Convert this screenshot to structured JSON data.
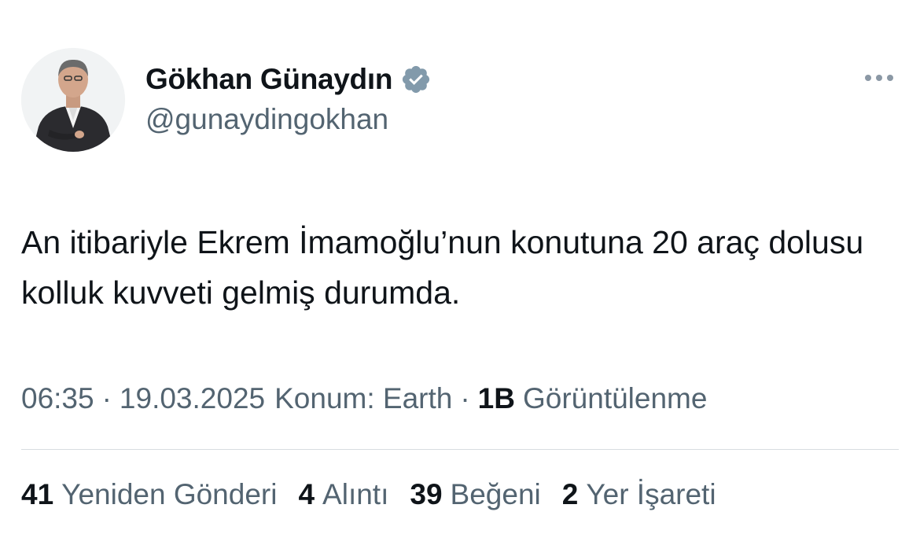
{
  "author": {
    "display_name": "Gökhan Günaydın",
    "handle": "@gunaydingokhan",
    "verified_badge_color": "#829aab",
    "icons": {
      "verified": "verified-badge-icon",
      "more": "more-options-icon"
    }
  },
  "tweet": {
    "text": "An itibariyle Ekrem İmamoğlu’nun konutuna 20 araç dolusu kolluk kuvveti gelmiş durumda."
  },
  "meta": {
    "time": "06:35",
    "separator": "·",
    "date": "19.03.2025",
    "location": "Konum: Earth",
    "views_count": "1B",
    "views_label": "Görüntülenme"
  },
  "stats": [
    {
      "count": "41",
      "label": "Yeniden Gönderi"
    },
    {
      "count": "4",
      "label": "Alıntı"
    },
    {
      "count": "39",
      "label": "Beğeni"
    },
    {
      "count": "2",
      "label": "Yer İşareti"
    }
  ]
}
